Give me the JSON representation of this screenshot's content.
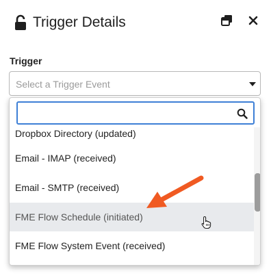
{
  "panel": {
    "title": "Trigger Details",
    "lock_icon": "unlocked-lock-icon",
    "restore_icon": "restore-window-icon",
    "close_icon": "close-icon"
  },
  "trigger": {
    "label": "Trigger",
    "placeholder": "Select a Trigger Event",
    "search_value": "",
    "items": [
      {
        "label": "Dropbox Directory (updated)"
      },
      {
        "label": "Email - IMAP (received)"
      },
      {
        "label": "Email - SMTP (received)"
      },
      {
        "label": "FME Flow Schedule (initiated)",
        "hovered": true
      },
      {
        "label": "FME Flow System Event (received)"
      }
    ]
  },
  "colors": {
    "focus_border": "#3d7fd6",
    "hover_background": "#e8eaed",
    "annotation_arrow": "#f05a22"
  }
}
